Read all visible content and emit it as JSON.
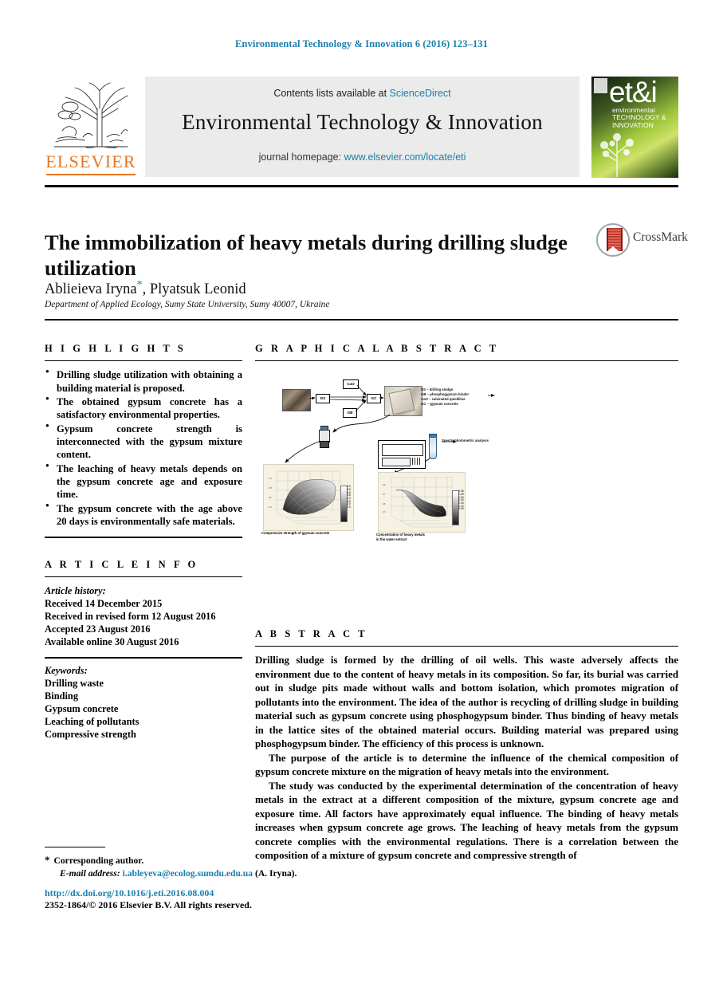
{
  "running_head": "Environmental Technology & Innovation 6 (2016) 123–131",
  "masthead": {
    "publisher_name": "ELSEVIER",
    "contents_prefix": "Contents lists available at ",
    "contents_link": "ScienceDirect",
    "journal_title": "Environmental Technology & Innovation",
    "homepage_prefix": "journal homepage: ",
    "homepage_link": "www.elsevier.com/locate/eti",
    "cover": {
      "logo_text": "et&i",
      "sub_line1": "environmental",
      "sub_line2": "TECHNOLOGY &",
      "sub_line3": "INNOVATION"
    }
  },
  "article": {
    "title": "The immobilization of heavy metals during drilling sludge utilization",
    "authors": "Ablieieva Iryna",
    "authors_tail": ", Plyatsuk Leonid",
    "corresponding_marker": "*",
    "affiliation": "Department of Applied Ecology, Sumy State University, Sumy 40007, Ukraine",
    "crossmark_label": "CrossMark"
  },
  "highlights": {
    "heading": "H I G H L I G H T S",
    "items": [
      "Drilling sludge utilization with obtaining a building material is proposed.",
      "The obtained gypsum concrete has a satisfactory environmental properties.",
      "Gypsum concrete strength is interconnected with the gypsum mixture content.",
      "The leaching of heavy metals depends on the gypsum concrete age and exposure time.",
      "The gypsum concrete with the age above 20 days is environmentally safe materials."
    ]
  },
  "article_info": {
    "heading": "A R T I C L E   I N F O",
    "history_label": "Article history:",
    "history": [
      "Received 14 December 2015",
      "Received in revised form 12 August 2016",
      "Accepted 23 August 2016",
      "Available online 30 August 2016"
    ],
    "keywords_label": "Keywords:",
    "keywords": [
      "Drilling waste",
      "Binding",
      "Gypsum concrete",
      "Leaching of pollutants",
      "Compressive strength"
    ]
  },
  "graphical_abstract": {
    "heading": "G R A P H I C A L   A B S T R A C T",
    "boxes": {
      "ds": "DS",
      "cao": "CaO",
      "gb": "GB",
      "gc": "GC"
    },
    "legend": [
      "DS – drilling sludge",
      "GB – phosphogypsum binder",
      "CaO – calcinated quicklime",
      "GC – gypsum concrete"
    ],
    "annotation": "Spectrophotometric analysis",
    "plot_a_axis": "Compressive strength of gypsum concrete",
    "plot_b_axis_1": "Concentration of heavy metals",
    "plot_b_axis_2": "in the water extract"
  },
  "abstract": {
    "heading": "A B S T R A C T",
    "paragraphs": [
      "Drilling sludge is formed by the drilling of oil wells. This waste adversely affects the environment due to the content of heavy metals in its composition. So far, its burial was carried out in sludge pits made without walls and bottom isolation, which promotes migration of pollutants into the environment. The idea of the author is recycling of drilling sludge in building material such as gypsum concrete using phosphogypsum binder. Thus binding of heavy metals in the lattice sites of the obtained material occurs. Building material was prepared using phosphogypsum binder. The efficiency of this process is unknown.",
      "The purpose of the article is to determine the influence of the chemical composition of gypsum concrete mixture on the migration of heavy metals into the environment.",
      "The study was conducted by the experimental determination of the concentration of heavy metals in the extract at a different composition of the mixture, gypsum concrete age and exposure time. All factors have approximately equal influence. The binding of heavy metals increases when gypsum concrete age grows. The leaching of heavy metals from the gypsum concrete complies with the environmental regulations. There is a correlation between the composition of a mixture of gypsum concrete and compressive strength of"
    ]
  },
  "footer": {
    "corresponding_marker": "*",
    "corresponding_text": "Corresponding author.",
    "email_label": "E-mail address:",
    "email": "i.ableyeva@ecolog.sumdu.edu.ua",
    "email_suffix": "(A. Iryna).",
    "doi": "http://dx.doi.org/10.1016/j.eti.2016.08.004",
    "copyright": "2352-1864/© 2016 Elsevier B.V. All rights reserved."
  }
}
